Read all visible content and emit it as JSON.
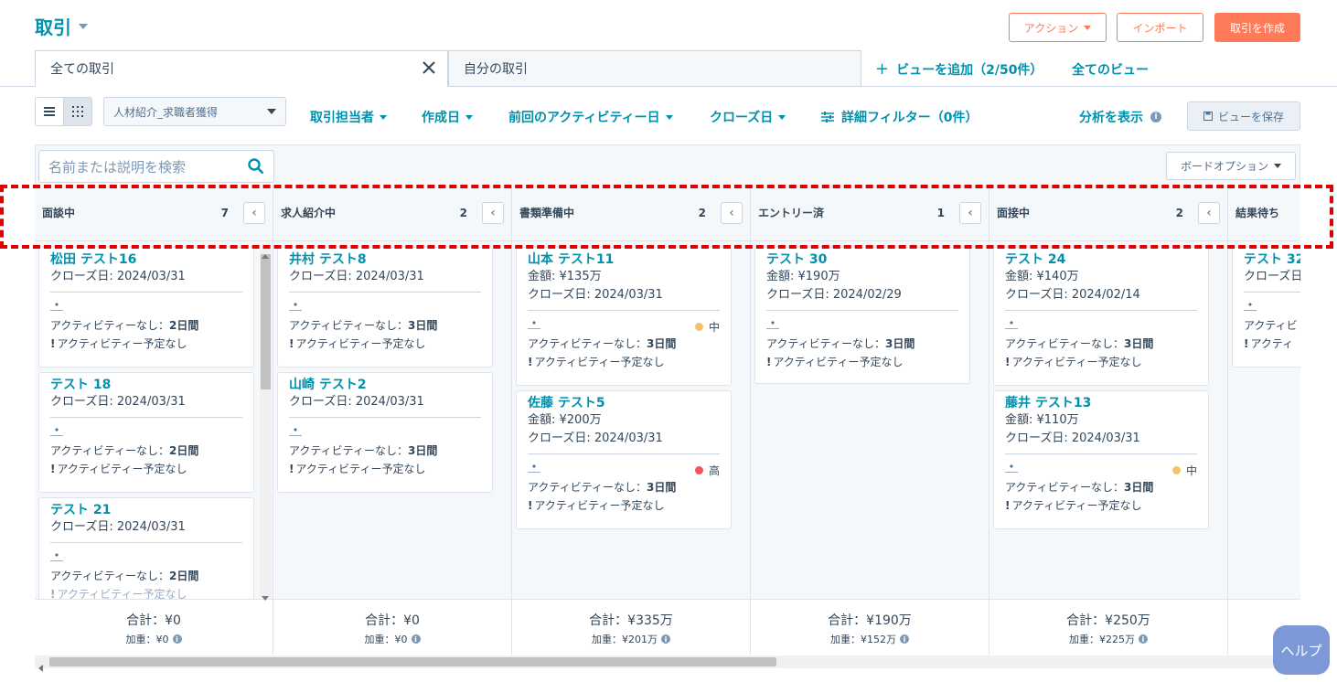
{
  "page": {
    "title": "取引"
  },
  "header": {
    "actions_label": "アクション",
    "import_label": "インポート",
    "create_label": "取引を作成"
  },
  "tabs": [
    {
      "label": "全ての取引"
    },
    {
      "label": "自分の取引"
    }
  ],
  "tab_links": {
    "add_view": "ビューを追加（2/50件）",
    "all_views": "全てのビュー"
  },
  "filters": {
    "pipeline_select": "人材紹介_求職者獲得",
    "owner": "取引担当者",
    "created": "作成日",
    "last_activity": "前回のアクティビティー日",
    "close_date": "クローズ日",
    "advanced": "詳細フィルター（0件）",
    "analysis": "分析を表示",
    "save_view": "ビューを保存"
  },
  "board": {
    "search_placeholder": "名前または説明を検索",
    "options_label": "ボードオプション"
  },
  "columns": [
    {
      "title": "面談中",
      "count": "7",
      "footer_total": "合計：¥0",
      "footer_weighted": "加重：¥0",
      "cards": [
        {
          "name": "松田 テスト16",
          "close": "クローズ日: 2024/03/31",
          "activity_prefix": "アクティビティーなし：",
          "activity_days": "2日間",
          "next": "アクティビティー予定なし"
        },
        {
          "name": "テスト 18",
          "close": "クローズ日: 2024/03/31",
          "activity_prefix": "アクティビティーなし：",
          "activity_days": "2日間",
          "next": "アクティビティー予定なし"
        },
        {
          "name": "テスト 21",
          "close": "クローズ日: 2024/03/31",
          "activity_prefix": "アクティビティーなし：",
          "activity_days": "2日間",
          "next": "アクティビティー予定なし"
        }
      ]
    },
    {
      "title": "求人紹介中",
      "count": "2",
      "footer_total": "合計：¥0",
      "footer_weighted": "加重：¥0",
      "cards": [
        {
          "name": "井村 テスト8",
          "close": "クローズ日: 2024/03/31",
          "activity_prefix": "アクティビティーなし：",
          "activity_days": "3日間",
          "next": "アクティビティー予定なし"
        },
        {
          "name": "山崎 テスト2",
          "close": "クローズ日: 2024/03/31",
          "activity_prefix": "アクティビティーなし：",
          "activity_days": "3日間",
          "next": "アクティビティー予定なし"
        }
      ]
    },
    {
      "title": "書類準備中",
      "count": "2",
      "footer_total": "合計：¥335万",
      "footer_weighted": "加重：¥201万",
      "cards": [
        {
          "name": "山本 テスト11",
          "amount": "金額: ¥135万",
          "close": "クローズ日: 2024/03/31",
          "priority": "中",
          "priority_color": "#f5c26b",
          "activity_prefix": "アクティビティーなし：",
          "activity_days": "3日間",
          "next": "アクティビティー予定なし"
        },
        {
          "name": "佐藤 テスト5",
          "amount": "金額: ¥200万",
          "close": "クローズ日: 2024/03/31",
          "priority": "高",
          "priority_color": "#f2545b",
          "activity_prefix": "アクティビティーなし：",
          "activity_days": "3日間",
          "next": "アクティビティー予定なし"
        }
      ]
    },
    {
      "title": "エントリー済",
      "count": "1",
      "footer_total": "合計：¥190万",
      "footer_weighted": "加重：¥152万",
      "cards": [
        {
          "name": "テスト 30",
          "amount": "金額: ¥190万",
          "close": "クローズ日: 2024/02/29",
          "activity_prefix": "アクティビティーなし：",
          "activity_days": "3日間",
          "next": "アクティビティー予定なし"
        }
      ]
    },
    {
      "title": "面接中",
      "count": "2",
      "footer_total": "合計：¥250万",
      "footer_weighted": "加重：¥225万",
      "cards": [
        {
          "name": "テスト 24",
          "amount": "金額: ¥140万",
          "close": "クローズ日: 2024/02/14",
          "activity_prefix": "アクティビティーなし：",
          "activity_days": "3日間",
          "next": "アクティビティー予定なし"
        },
        {
          "name": "藤井 テスト13",
          "amount": "金額: ¥110万",
          "close": "クローズ日: 2024/03/31",
          "priority": "中",
          "priority_color": "#f5c26b",
          "activity_prefix": "アクティビティーなし：",
          "activity_days": "3日間",
          "next": "アクティビティー予定なし"
        }
      ]
    },
    {
      "title": "結果待ち",
      "cards": [
        {
          "name": "テスト 32",
          "close": "クローズ日",
          "activity_prefix": "アクティビ",
          "next": "アクティ"
        }
      ]
    }
  ],
  "help_label": "ヘルプ"
}
